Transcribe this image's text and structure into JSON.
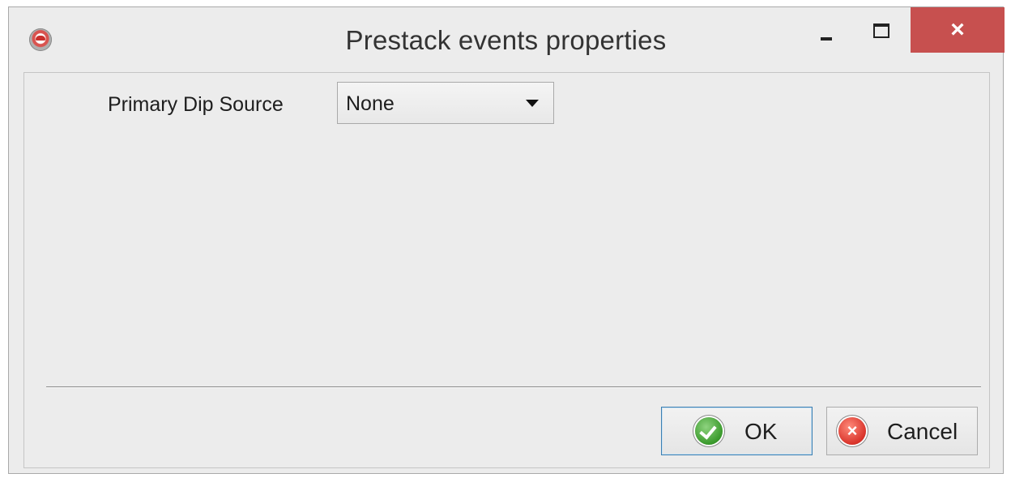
{
  "window": {
    "title": "Prestack events properties",
    "close_glyph": "×"
  },
  "form": {
    "primary_dip_source_label": "Primary Dip Source",
    "primary_dip_source_value": "None"
  },
  "buttons": {
    "ok_label": "OK",
    "cancel_label": "Cancel",
    "cancel_icon_glyph": "×"
  },
  "icons": {
    "app": "app-logo-icon",
    "minimize": "minimize-icon",
    "maximize": "maximize-icon",
    "close": "close-icon",
    "dropdown": "chevron-down-icon",
    "ok": "check-circle-icon",
    "cancel": "x-circle-icon"
  },
  "colors": {
    "close_button": "#c7504f",
    "ok_icon": "#3a9a2c",
    "cancel_icon": "#d9342b",
    "ok_focus_border": "#3c7fb1"
  }
}
